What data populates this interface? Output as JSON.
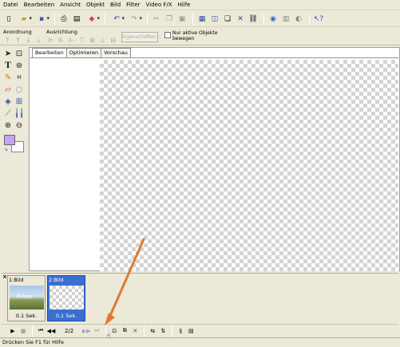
{
  "menu": [
    "Datei",
    "Bearbeiten",
    "Ansicht",
    "Objekt",
    "Bild",
    "Filter",
    "Video F/X",
    "Hilfe"
  ],
  "toolbar_icons": [
    "new-file-icon",
    "open-icon",
    "save-icon",
    "print-icon",
    "scanner-icon",
    "color-adjust-icon",
    "undo-icon",
    "redo-icon",
    "cut-icon",
    "copy-icon",
    "paste-icon",
    "image-icon",
    "frame-icon",
    "copy-object-icon",
    "delete-icon",
    "link-icon",
    "globe-icon",
    "properties-icon",
    "help-icon"
  ],
  "arrange": {
    "anordnung_label": "Anordnung",
    "ausrichtung_label": "Ausrichtung",
    "properties_button": "Eigenschaften...",
    "checkbox_label": "Nur aktive Objekte bewegen"
  },
  "tabs": [
    "Bearbeiten",
    "Optimieren",
    "Vorschau"
  ],
  "frames": [
    {
      "title": "1:Bild",
      "time": "0.1 Sek.",
      "thumb_text": "Prime"
    },
    {
      "title": "2:Bild",
      "time": "0.1 Sek."
    }
  ],
  "playback": {
    "counter": "2/2"
  },
  "status": "Drücken Sie F1 für Hilfe",
  "colors": {
    "foreground": "#c8a2f0",
    "background": "#ffffff",
    "selection": "#3a6fd0",
    "annotation_arrow": "#e07a2e"
  }
}
